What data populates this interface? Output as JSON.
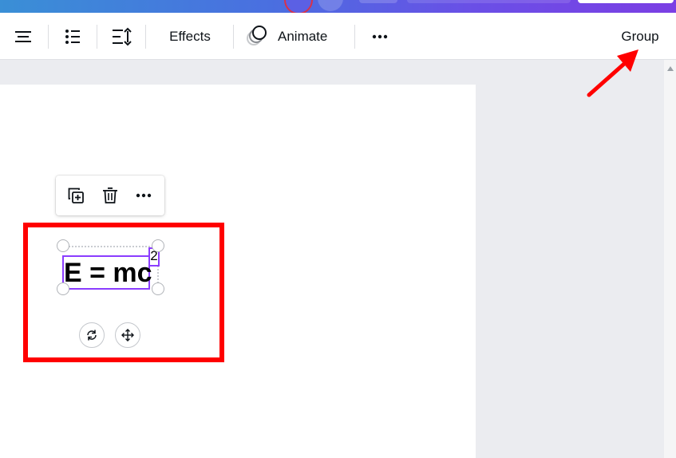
{
  "toolbar": {
    "effects_label": "Effects",
    "animate_label": "Animate",
    "group_label": "Group"
  },
  "element": {
    "text": "E = mc",
    "superscript": "2"
  },
  "colors": {
    "selection_accent": "#8b3dff",
    "highlight": "#ff0000",
    "annotation_arrow": "#ff0000",
    "header_gradient_start": "#3a8fd6",
    "header_gradient_end": "#7b3fe4"
  },
  "icons": {
    "toolbar": [
      "align-center-icon",
      "list-icon",
      "spacing-icon",
      "animate-circles-icon",
      "more-horizontal-icon"
    ],
    "context_menu": [
      "duplicate-icon",
      "trash-icon",
      "more-horizontal-icon"
    ],
    "element_controls": [
      "rotate-icon",
      "move-icon"
    ]
  }
}
